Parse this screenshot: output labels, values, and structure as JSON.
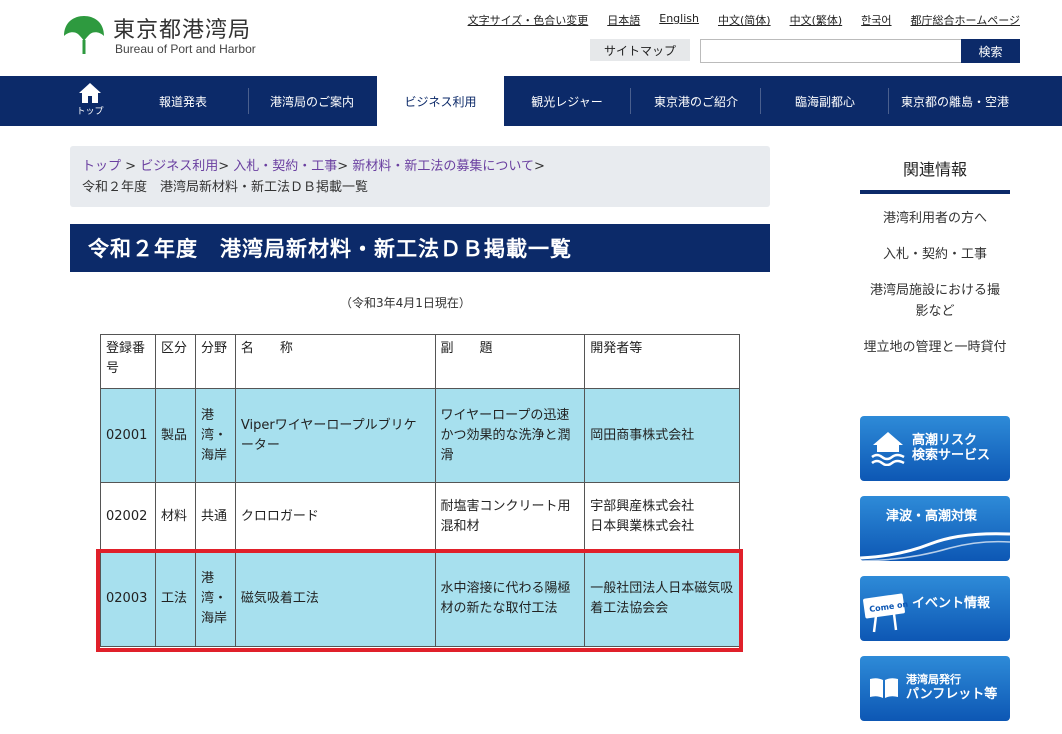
{
  "header": {
    "logo_title": "東京都港湾局",
    "logo_subtitle": "Bureau of Port and Harbor",
    "util_links": [
      "文字サイズ・色合い変更",
      "日本語",
      "English",
      "中文(简体)",
      "中文(繁体)",
      "한국어",
      "都庁総合ホームページ"
    ],
    "sitemap_label": "サイトマップ",
    "search_placeholder": "",
    "search_button": "検索"
  },
  "nav": {
    "home_label": "トップ",
    "items": [
      "報道発表",
      "港湾局のご案内",
      "ビジネス利用",
      "観光レジャー",
      "東京港のご紹介",
      "臨海副都心",
      "東京都の離島・空港"
    ],
    "active_index": 2
  },
  "breadcrumb": {
    "items": [
      "トップ",
      "ビジネス利用",
      "入札・契約・工事",
      "新材料・新工法の募集について"
    ],
    "separator": ">",
    "current": "令和２年度　港湾局新材料・新工法ＤＢ掲載一覧"
  },
  "page_title": "令和２年度　港湾局新材料・新工法ＤＢ掲載一覧",
  "date_note": "（令和3年4月1日現在）",
  "table": {
    "headers": [
      "登録番号",
      "区分",
      "分野",
      "名　　称",
      "副　　題",
      "開発者等"
    ],
    "rows": [
      {
        "no": "02001",
        "kubun": "製品",
        "bunya": "港湾・海岸",
        "name": "Viperワイヤーロープルブリケーター",
        "subtitle": "ワイヤーロープの迅速かつ効果的な洗浄と潤滑",
        "developer": "岡田商事株式会社"
      },
      {
        "no": "02002",
        "kubun": "材料",
        "bunya": "共通",
        "name": "クロロガード",
        "subtitle": "耐塩害コンクリート用混和材",
        "developer": "宇部興産株式会社\n日本興業株式会社"
      },
      {
        "no": "02003",
        "kubun": "工法",
        "bunya": "港湾・海岸",
        "name": "磁気吸着工法",
        "subtitle": "水中溶接に代わる陽極材の新たな取付工法",
        "developer": "一般社団法人日本磁気吸着工法協会会"
      }
    ]
  },
  "sidebar": {
    "heading": "関連情報",
    "links": [
      "港湾利用者の方へ",
      "入札・契約・工事",
      "港湾局施設における撮影など",
      "埋立地の管理と一時貸付"
    ],
    "banners": {
      "b1_line1": "高潮リスク",
      "b1_line2": "検索サービス",
      "b2": "津波・高潮対策",
      "b3_sign": "Come on",
      "b3": "イベント情報",
      "b4_line1": "港湾局発行",
      "b4_line2": "パンフレット等"
    }
  },
  "colors": {
    "navy": "#0c2a69",
    "row_highlight": "#a7e0ee",
    "frame_red": "#e0202a",
    "logo_green": "#2e9a3f"
  }
}
